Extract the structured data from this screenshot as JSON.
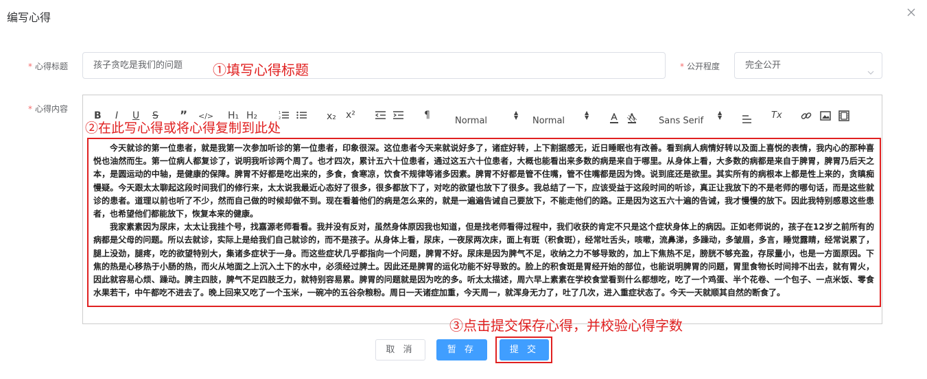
{
  "dialog": {
    "title": "编写心得",
    "close_icon": "close-icon"
  },
  "form": {
    "title_label": "心得标题",
    "title_value": "孩子贪吃是我们的问题",
    "visibility_label": "公开程度",
    "visibility_value": "完全公开",
    "content_label": "心得内容",
    "required_mark": "*"
  },
  "annotations": {
    "step1": "①填写心得标题",
    "step2": "②在此写心得或将心得复制到此处",
    "step3": "③点击提交保存心得，并校验心得字数"
  },
  "toolbar": {
    "bold": "B",
    "italic": "I",
    "underline": "U",
    "strike": "S",
    "blockquote": "”",
    "code": "</>",
    "h1": "H₁",
    "h2": "H₂",
    "subscript": "x₂",
    "superscript": "x²",
    "direction": "¶",
    "size_value": "Normal",
    "header_value": "Normal",
    "font_value": "Sans Serif",
    "clean": "Tx"
  },
  "content": {
    "paragraphs": [
      "今天就诊的第一位患者，就是我第一次参加听诊的第一位患者，印象很深。这位患者今天来就说好多了，诸症好转，上下割据感无，近日睡眠也有改善。看到病人病情好转以及面上喜悦的表情，我内心的那种喜悦也油然而生。第一位病人都复诊了，说明我听诊两个周了。也才四次，累计五六十位患者，通过这五六十位患者，大概也能看出来多数的病是来自于哪里。从身体上看，大多数的病都是来自于脾胃，脾胃乃后天之本，是圆运动的中轴，是健康的保障。脾胃不好都是吃出来的，多食，食寒凉，饮食不规律等诸多因素。脾胃不好都是管不住嘴，管不住嘴都是因为馋。说到底还是欲里。其实所有的病根本上都是性上来的，贪瞋痴慢疑。今天跟太太聊起这段时间我们的修行来，太太说我最近心态好了很多，很多都放下了，对吃的欲望也放下了很多。我总结了一下，应该受益于这段时间的听诊，真正让我放下的不是老师的哪句话，而是这些就诊的患者。道理以前也听了不少，然而自己做的时候却做不到。现在看着他们的病是怎么来的，就是一遍遍告诫自己要放下，不能走他们的路。正是因为这五六十遍的告诫，我才慢慢的放下。因此我特别感恩这些患者，也希望他们都能放下，恢复本来的健康。",
      "我家素素因为尿床，太太让我挂个号，找嘉源老师看看。我并没有反对，虽然身体原因我也知道，但是找老师看得过程中，我们收获的肯定不只是这个症状身体上的病因。正如老师说的，孩子在12岁之前所有的病都是父母的问题。所以去就诊，实际上是给我们自己就诊的，而不是孩子。从身体上看，尿床，一夜尿两次床，面上有斑（积食斑），经常吐舌头，咳嗽，流鼻涕，多躁动，多皱眉，多言，睡觉露睛，经常说累了，腿上没劲，腿疼，吃的欲望特别大，集诸多症状于一身。而这些症状几乎都指向一个问题，脾胃不好。尿床是因为脾气不足，收纳之力不够导致的，加上下焦热不足，膀胱不够充盈，存尿量小，也是一方面原因。下焦的热是心移热于小肠的热，而火从地面之上沉入土下的水中，必须经过脾土。因此还是脾胃的运化功能不好导致的。脸上的积食斑是胃经开始的部位，也能说明脾胃的问题，胃里食物长时间排不出去，就有胃火，因此就容易心烦、躁动。脾主四肢，脾气不足四肢乏力，就特别容易累。脾胃的问题就是因为吃的多。听太太描述，周六早上素素在学校食堂看到什么都想吃，吃了一个鸡蛋、半个花卷、一个包子、一点米饭、零食水果若干，中午都吃不进去了。晚上回来又吃了一个玉米，一碗冲的五谷杂粮粉。周日一天诸症加重，今天周一，就浑身无力了，吐了几次，进入重症状态了。今天一天就顺其自然的断食了。"
    ]
  },
  "buttons": {
    "cancel": "取 消",
    "save": "暂 存",
    "submit": "提 交"
  },
  "colors": {
    "primary": "#409eff",
    "annotation_red": "#e02020",
    "required_red": "#f56c6c"
  }
}
